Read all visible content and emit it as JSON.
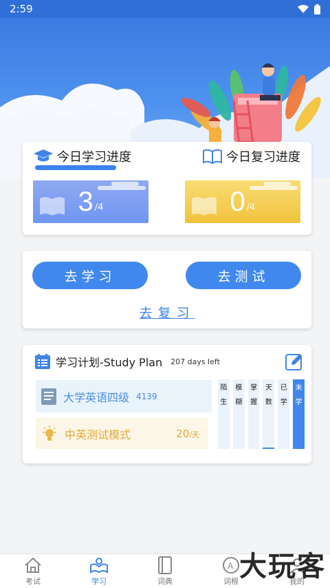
{
  "status": {
    "time": "2:59"
  },
  "progress": {
    "today_study_label": "今日学习进度",
    "today_review_label": "今日复习进度",
    "study_done": "3",
    "study_total": "/4",
    "review_done": "0",
    "review_total": "/4"
  },
  "actions": {
    "study_button": "去学习",
    "test_button": "去测试",
    "review_link": "去复习"
  },
  "plan": {
    "title": "学习计划-Study Plan",
    "days_left": "207 days left",
    "book_name": "大学英语四级",
    "book_count": "4139",
    "mode_name": "中英测试模式",
    "per_day_value": "20",
    "per_day_unit": "/天",
    "bars": [
      {
        "label": "陌\n生",
        "level": 0
      },
      {
        "label": "模\n糊",
        "level": 0
      },
      {
        "label": "掌\n握",
        "level": 0
      },
      {
        "label": "天\n数",
        "level": 0.02
      },
      {
        "label": "已\n学",
        "level": 0
      },
      {
        "label": "未\n学",
        "level": 1
      }
    ]
  },
  "tabs": [
    {
      "label": "考试",
      "icon": "home-icon"
    },
    {
      "label": "学习",
      "icon": "study-icon"
    },
    {
      "label": "词典",
      "icon": "dictionary-icon"
    },
    {
      "label": "词根",
      "icon": "word-root-icon"
    },
    {
      "label": "我的",
      "icon": "profile-icon"
    }
  ],
  "watermark": "大玩客",
  "colors": {
    "primary": "#4188ee",
    "gold": "#f1c33c",
    "status_bar": "#2f6fd7"
  }
}
